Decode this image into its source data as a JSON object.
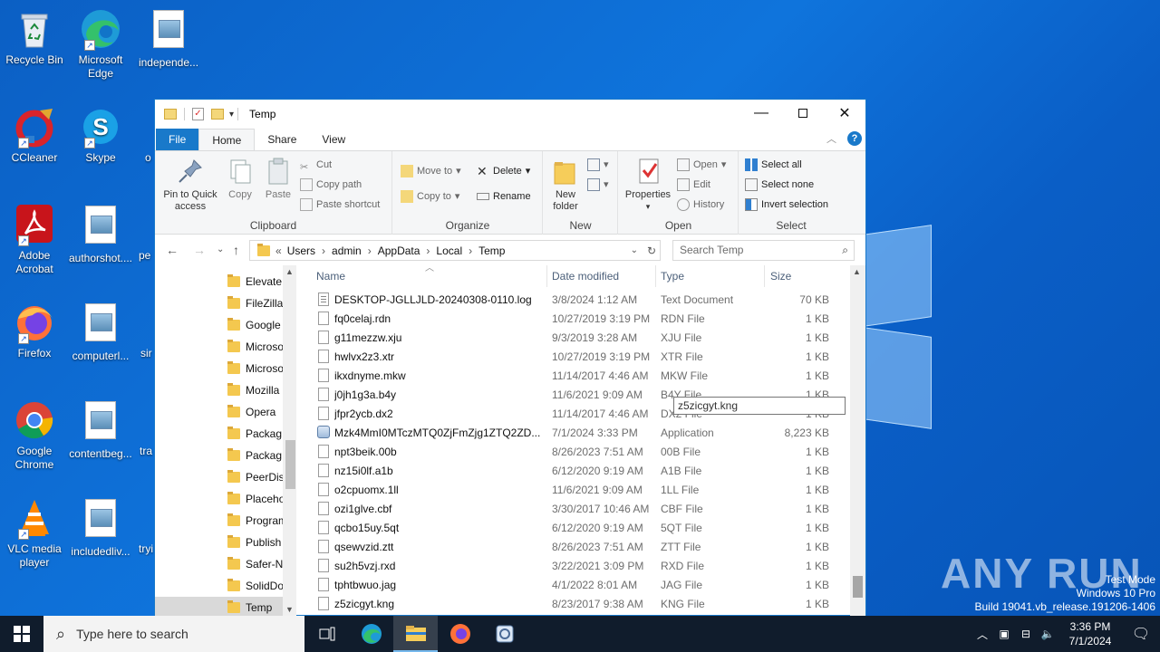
{
  "desktop": {
    "icons": [
      {
        "label": "Recycle Bin",
        "kind": "recycle"
      },
      {
        "label": "Microsoft Edge",
        "kind": "edge"
      },
      {
        "label": "independe...",
        "kind": "doc"
      },
      {
        "label": "CCleaner",
        "kind": "ccleaner"
      },
      {
        "label": "Skype",
        "kind": "skype"
      },
      {
        "label": "Adobe Acrobat",
        "kind": "acrobat"
      },
      {
        "label": "authorshot....",
        "kind": "doc"
      },
      {
        "label": "Firefox",
        "kind": "firefox"
      },
      {
        "label": "computerl...",
        "kind": "doc"
      },
      {
        "label": "Google Chrome",
        "kind": "chrome"
      },
      {
        "label": "contentbeg...",
        "kind": "doc"
      },
      {
        "label": "VLC media player",
        "kind": "vlc"
      },
      {
        "label": "includedliv...",
        "kind": "doc"
      }
    ],
    "partial_labels": {
      "o": "o",
      "pe": "pe",
      "sir": "sir",
      "tra": "tra",
      "tryi": "tryi"
    },
    "watermark": {
      "brand": "ANY RUN",
      "line1": "Test Mode",
      "line2": "Windows 10 Pro",
      "line3": "Build 19041.vb_release.191206-1406"
    }
  },
  "window": {
    "title": "Temp",
    "tabs": {
      "file": "File",
      "home": "Home",
      "share": "Share",
      "view": "View"
    },
    "help": "?",
    "ribbon": {
      "clipboard": {
        "label": "Clipboard",
        "pin_label": "Pin to Quick access",
        "copy": "Copy",
        "paste": "Paste",
        "cut": "Cut",
        "copy_path": "Copy path",
        "paste_shortcut": "Paste shortcut"
      },
      "organize": {
        "label": "Organize",
        "move_to": "Move to",
        "copy_to": "Copy to",
        "delete": "Delete",
        "rename": "Rename"
      },
      "new": {
        "label": "New",
        "new_folder": "New folder"
      },
      "open": {
        "label": "Open",
        "properties": "Properties",
        "open": "Open",
        "edit": "Edit",
        "history": "History"
      },
      "select": {
        "label": "Select",
        "select_all": "Select all",
        "select_none": "Select none",
        "invert": "Invert selection"
      }
    },
    "address": {
      "path": [
        "Users",
        "admin",
        "AppData",
        "Local",
        "Temp"
      ],
      "search_placeholder": "Search Temp"
    },
    "nav_items": [
      "Elevate",
      "FileZilla",
      "Google",
      "Microso",
      "Microso",
      "Mozilla",
      "Opera",
      "Packag",
      "Packag",
      "PeerDis",
      "Placeho",
      "Program",
      "Publish",
      "Safer-N",
      "SolidDo",
      "Temp"
    ],
    "columns": {
      "name": "Name",
      "date": "Date modified",
      "type": "Type",
      "size": "Size"
    },
    "files": [
      {
        "name": "DESKTOP-JGLLJLD-20240308-0110.log",
        "date": "3/8/2024 1:12 AM",
        "type": "Text Document",
        "size": "70 KB",
        "icon": "txt"
      },
      {
        "name": "fq0celaj.rdn",
        "date": "10/27/2019 3:19 PM",
        "type": "RDN File",
        "size": "1 KB",
        "icon": "file"
      },
      {
        "name": "g11mezzw.xju",
        "date": "9/3/2019 3:28 AM",
        "type": "XJU File",
        "size": "1 KB",
        "icon": "file"
      },
      {
        "name": "hwlvx2z3.xtr",
        "date": "10/27/2019 3:19 PM",
        "type": "XTR File",
        "size": "1 KB",
        "icon": "file"
      },
      {
        "name": "ikxdnyme.mkw",
        "date": "11/14/2017 4:46 AM",
        "type": "MKW File",
        "size": "1 KB",
        "icon": "file"
      },
      {
        "name": "j0jh1g3a.b4y",
        "date": "11/6/2021 9:09 AM",
        "type": "B4Y File",
        "size": "1 KB",
        "icon": "file"
      },
      {
        "name": "jfpr2ycb.dx2",
        "date": "11/14/2017 4:46 AM",
        "type": "DX2 File",
        "size": "1 KB",
        "icon": "file"
      },
      {
        "name": "Mzk4MmI0MTczMTQ0ZjFmZjg1ZTQ2ZD...",
        "date": "7/1/2024 3:33 PM",
        "type": "Application",
        "size": "8,223 KB",
        "icon": "app"
      },
      {
        "name": "npt3beik.00b",
        "date": "8/26/2023 7:51 AM",
        "type": "00B File",
        "size": "1 KB",
        "icon": "file"
      },
      {
        "name": "nz15i0lf.a1b",
        "date": "6/12/2020 9:19 AM",
        "type": "A1B File",
        "size": "1 KB",
        "icon": "file"
      },
      {
        "name": "o2cpuomx.1ll",
        "date": "11/6/2021 9:09 AM",
        "type": "1LL File",
        "size": "1 KB",
        "icon": "file"
      },
      {
        "name": "ozi1glve.cbf",
        "date": "3/30/2017 10:46 AM",
        "type": "CBF File",
        "size": "1 KB",
        "icon": "file"
      },
      {
        "name": "qcbo15uy.5qt",
        "date": "6/12/2020 9:19 AM",
        "type": "5QT File",
        "size": "1 KB",
        "icon": "file"
      },
      {
        "name": "qsewvzid.ztt",
        "date": "8/26/2023 7:51 AM",
        "type": "ZTT File",
        "size": "1 KB",
        "icon": "file"
      },
      {
        "name": "su2h5vzj.rxd",
        "date": "3/22/2021 3:09 PM",
        "type": "RXD File",
        "size": "1 KB",
        "icon": "file"
      },
      {
        "name": "tphtbwuo.jag",
        "date": "4/1/2022 8:01 AM",
        "type": "JAG File",
        "size": "1 KB",
        "icon": "file"
      },
      {
        "name": "z5zicgyt.kng",
        "date": "8/23/2017 9:38 AM",
        "type": "KNG File",
        "size": "1 KB",
        "icon": "file"
      }
    ],
    "tooltip": "z5zicgyt.kng"
  },
  "taskbar": {
    "search_placeholder": "Type here to search",
    "time": "3:36 PM",
    "date": "7/1/2024"
  }
}
